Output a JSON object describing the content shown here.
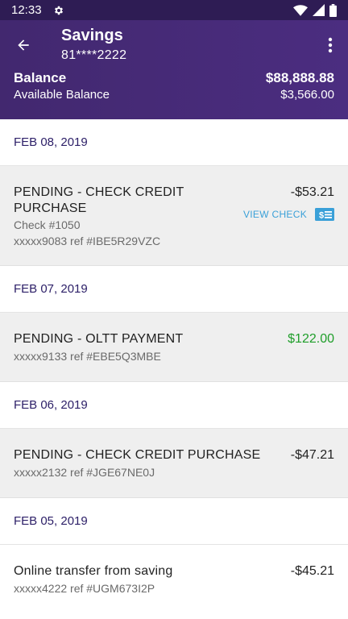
{
  "status_bar": {
    "time": "12:33",
    "icons": [
      "gear-icon",
      "wifi-icon",
      "signal-icon",
      "battery-icon"
    ]
  },
  "header": {
    "title": "Savings",
    "account_number": "81****2222",
    "balance_label": "Balance",
    "balance_value": "$88,888.88",
    "available_label": "Available Balance",
    "available_value": "$3,566.00"
  },
  "colors": {
    "header_bg": "#4b2d80",
    "date_text": "#2d2068",
    "positive_amount": "#1f9e2a",
    "link": "#3aa0d8"
  },
  "groups": [
    {
      "date": "FEB 08, 2019",
      "transactions": [
        {
          "line1": "PENDING - CHECK CREDIT",
          "line2": "PURCHASE",
          "check": "Check #1050",
          "ref": "xxxxx9083 ref #IBE5R29VZC",
          "amount": "-$53.21",
          "view_check": "VIEW CHECK"
        }
      ]
    },
    {
      "date": "FEB 07, 2019",
      "transactions": [
        {
          "line1": "PENDING - OLTT PAYMENT",
          "ref": "xxxxx9133 ref #EBE5Q3MBE",
          "amount": "$122.00"
        }
      ]
    },
    {
      "date": "FEB 06, 2019",
      "transactions": [
        {
          "line1": "PENDING - CHECK CREDIT PURCHASE",
          "ref": "xxxxx2132 ref #JGE67NE0J",
          "amount": "-$47.21"
        }
      ]
    },
    {
      "date": "FEB 05, 2019",
      "transactions": [
        {
          "line1": "Online transfer from saving",
          "ref": "xxxxx4222 ref #UGM673I2P",
          "amount": "-$45.21"
        }
      ]
    }
  ]
}
